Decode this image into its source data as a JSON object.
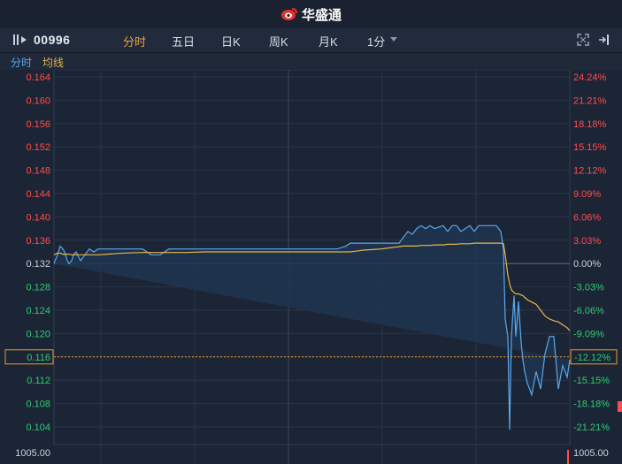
{
  "brand": {
    "name": "华盛通",
    "logo_icon": "weibo-eye-logo-icon"
  },
  "toolbar": {
    "stock_code": "00996",
    "tabs": [
      {
        "label": "分时",
        "active": true
      },
      {
        "label": "五日",
        "active": false
      },
      {
        "label": "日K",
        "active": false
      },
      {
        "label": "周K",
        "active": false
      },
      {
        "label": "月K",
        "active": false
      },
      {
        "label": "1分",
        "active": false
      }
    ],
    "icons": [
      "back-arrow-icon",
      "fullscreen-icon",
      "exit-panel-icon"
    ]
  },
  "legend": {
    "price_label": "分时",
    "avg_label": "均线",
    "price_color": "#5aa8ee",
    "avg_color": "#e8b64a"
  },
  "colors": {
    "up": "#ff4d4d",
    "down": "#2ecc71",
    "neutral": "#c8d0dc",
    "crosshair": "#e89a2a"
  },
  "cursor": {
    "price_label": "0.116",
    "pct_label": "-12.12%"
  },
  "volume": {
    "left_label": "1005.00",
    "right_label": "1005.00"
  },
  "chart_data": {
    "type": "line",
    "prev_close": 0.132,
    "ylim": [
      0.1,
      0.166
    ],
    "y_ticks": [
      0.164,
      0.16,
      0.156,
      0.152,
      0.148,
      0.144,
      0.14,
      0.136,
      0.132,
      0.128,
      0.124,
      0.12,
      0.116,
      0.112,
      0.108,
      0.104
    ],
    "y_tick_labels": [
      "0.164",
      "0.160",
      "0.156",
      "0.152",
      "0.148",
      "0.144",
      "0.140",
      "0.136",
      "0.132",
      "0.128",
      "0.124",
      "0.120",
      "0.116",
      "0.112",
      "0.108",
      "0.104"
    ],
    "pct_labels": [
      "24.24%",
      "21.21%",
      "18.18%",
      "15.15%",
      "12.12%",
      "9.09%",
      "6.06%",
      "3.03%",
      "0.00%",
      "-3.03%",
      "-6.06%",
      "-9.09%",
      "-12.12%",
      "-15.15%",
      "-18.18%",
      "-21.21%"
    ],
    "x": [
      0,
      4,
      7,
      10,
      12,
      15,
      17,
      20,
      22,
      25,
      30,
      35,
      40,
      45,
      50,
      60,
      80,
      100,
      110,
      120,
      130,
      150,
      170,
      180,
      190,
      195,
      200,
      220,
      225,
      230,
      260,
      270,
      280,
      290,
      300,
      320,
      330,
      335,
      340,
      345,
      350,
      360,
      370,
      375,
      380,
      385,
      390,
      395,
      400,
      405,
      410,
      415,
      420,
      425,
      430,
      440,
      445,
      450,
      455,
      460,
      470,
      475,
      480,
      485,
      490,
      495,
      500,
      505,
      508,
      510,
      513,
      515,
      517,
      520,
      522,
      525,
      528,
      530,
      532,
      535,
      540,
      545,
      550,
      555,
      560,
      565,
      570,
      575,
      580,
      583
    ],
    "series": [
      {
        "name": "分时",
        "values": [
          0.132,
          0.1335,
          0.135,
          0.1345,
          0.134,
          0.1325,
          0.132,
          0.1325,
          0.1335,
          0.134,
          0.1325,
          0.1335,
          0.1345,
          0.134,
          0.1345,
          0.1345,
          0.1345,
          0.1345,
          0.1335,
          0.1335,
          0.1345,
          0.1345,
          0.1345,
          0.1345,
          0.1345,
          0.1345,
          0.1345,
          0.1345,
          0.1345,
          0.1345,
          0.1345,
          0.1345,
          0.1345,
          0.1345,
          0.1345,
          0.1345,
          0.135,
          0.1355,
          0.1355,
          0.1355,
          0.1355,
          0.1355,
          0.1355,
          0.1355,
          0.1355,
          0.1355,
          0.1355,
          0.1365,
          0.1375,
          0.137,
          0.138,
          0.1385,
          0.138,
          0.1385,
          0.138,
          0.1385,
          0.1375,
          0.1385,
          0.1385,
          0.1375,
          0.1385,
          0.1375,
          0.1385,
          0.1385,
          0.1385,
          0.1385,
          0.1385,
          0.1375,
          0.1345,
          0.1225,
          0.1195,
          0.1035,
          0.1195,
          0.1265,
          0.1195,
          0.1255,
          0.1185,
          0.1155,
          0.1135,
          0.1115,
          0.1095,
          0.1135,
          0.1105,
          0.1165,
          0.1195,
          0.1195,
          0.1105,
          0.1145,
          0.1125,
          0.1155,
          0.116
        ]
      },
      {
        "name": "均线",
        "values": [
          0.1335,
          0.1338,
          0.1338,
          0.1336,
          0.1336,
          0.1336,
          0.1336,
          0.1335,
          0.1335,
          0.1335,
          0.1335,
          0.1335,
          0.1335,
          0.1335,
          0.1335,
          0.1336,
          0.1338,
          0.1339,
          0.1339,
          0.1339,
          0.1339,
          0.1339,
          0.134,
          0.134,
          0.134,
          0.134,
          0.134,
          0.134,
          0.134,
          0.134,
          0.134,
          0.134,
          0.134,
          0.134,
          0.134,
          0.134,
          0.134,
          0.134,
          0.1341,
          0.1342,
          0.1343,
          0.1344,
          0.1345,
          0.1346,
          0.1347,
          0.1348,
          0.1349,
          0.135,
          0.135,
          0.135,
          0.135,
          0.1351,
          0.1351,
          0.1351,
          0.1352,
          0.1352,
          0.1353,
          0.1353,
          0.1353,
          0.1354,
          0.1354,
          0.1355,
          0.1355,
          0.1355,
          0.1355,
          0.1355,
          0.1355,
          0.1355,
          0.1354,
          0.1335,
          0.13,
          0.1285,
          0.1275,
          0.127,
          0.1268,
          0.1268,
          0.1266,
          0.1265,
          0.1262,
          0.1258,
          0.1254,
          0.125,
          0.124,
          0.123,
          0.1225,
          0.1222,
          0.122,
          0.1215,
          0.121,
          0.1205,
          0.1202
        ]
      }
    ]
  }
}
